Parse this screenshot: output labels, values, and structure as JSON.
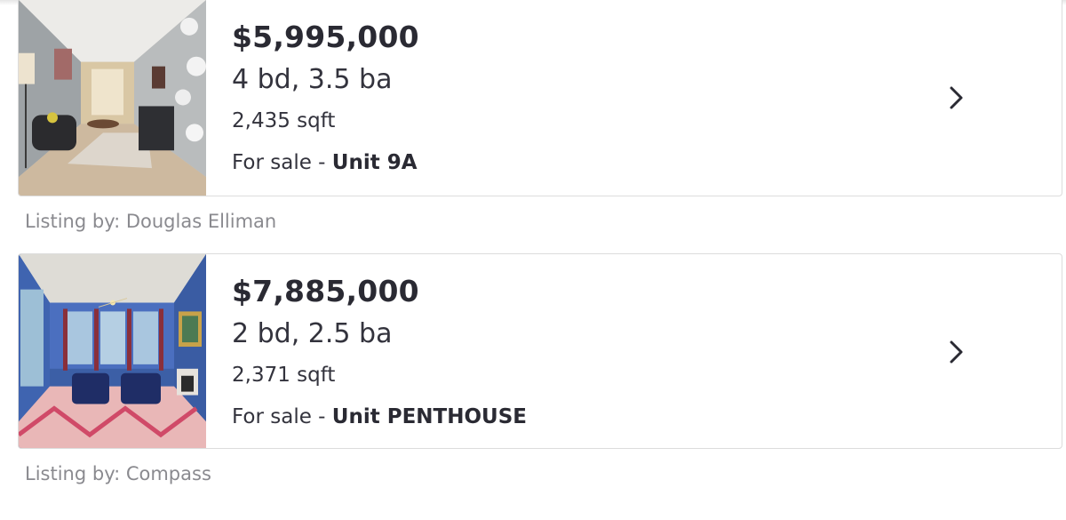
{
  "listings": [
    {
      "price": "$5,995,000",
      "beds_baths": "4 bd, 3.5 ba",
      "sqft": "2,435 sqft",
      "status_prefix": "For sale - ",
      "unit": "Unit 9A",
      "listing_by": "Listing by: Douglas Elliman",
      "image": "living-room-photo-1",
      "chevron": "chevron-right-icon"
    },
    {
      "price": "$7,885,000",
      "beds_baths": "2 bd, 2.5 ba",
      "sqft": "2,371 sqft",
      "status_prefix": "For sale - ",
      "unit": "Unit PENTHOUSE",
      "listing_by": "Listing by: Compass",
      "image": "living-room-photo-2",
      "chevron": "chevron-right-icon"
    }
  ],
  "colors": {
    "text": "#2a2a33",
    "muted": "#8a8a8f",
    "border": "#dcdcdc"
  }
}
